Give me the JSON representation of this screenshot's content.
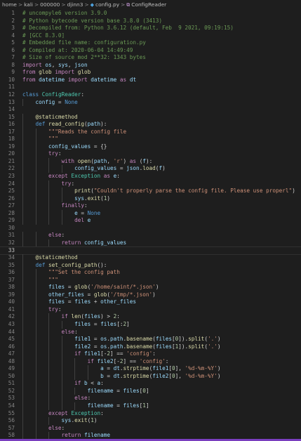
{
  "breadcrumb": {
    "items": [
      "home",
      "kali",
      "000000",
      "djinn3"
    ],
    "file": "config.py",
    "symbol": "ConfigReader",
    "separator": ">"
  },
  "colors": {
    "background": "#1e1e1e",
    "comment": "#6a9955",
    "keyword": "#c586c0",
    "storage": "#569cd6",
    "class": "#4ec9b0",
    "function": "#dcdcaa",
    "variable": "#9cdcfe",
    "string": "#ce9178",
    "number": "#b5cea8"
  },
  "editor": {
    "current_line": 33,
    "lines": [
      {
        "n": 1,
        "t": "# uncompyle6 version 3.9.0"
      },
      {
        "n": 2,
        "t": "# Python bytecode version base 3.8.0 (3413)"
      },
      {
        "n": 3,
        "t": "# Decompiled from: Python 3.6.12 (default, Feb  9 2021, 09:19:15)"
      },
      {
        "n": 4,
        "t": "# [GCC 8.3.0]"
      },
      {
        "n": 5,
        "t": "# Embedded file name: configuration.py"
      },
      {
        "n": 6,
        "t": "# Compiled at: 2020-06-04 14:49:49"
      },
      {
        "n": 7,
        "t": "# Size of source mod 2**32: 1343 bytes"
      },
      {
        "n": 8,
        "t": "import os, sys, json"
      },
      {
        "n": 9,
        "t": "from glob import glob"
      },
      {
        "n": 10,
        "t": "from datetime import datetime as dt"
      },
      {
        "n": 11,
        "t": ""
      },
      {
        "n": 12,
        "t": "class ConfigReader:"
      },
      {
        "n": 13,
        "t": "    config = None"
      },
      {
        "n": 14,
        "t": ""
      },
      {
        "n": 15,
        "t": "    @staticmethod"
      },
      {
        "n": 16,
        "t": "    def read_config(path):"
      },
      {
        "n": 17,
        "t": "        \"\"\"Reads the config file"
      },
      {
        "n": 18,
        "t": "        \"\"\""
      },
      {
        "n": 19,
        "t": "        config_values = {}"
      },
      {
        "n": 20,
        "t": "        try:"
      },
      {
        "n": 21,
        "t": "            with open(path, 'r') as (f):"
      },
      {
        "n": 22,
        "t": "                config_values = json.load(f)"
      },
      {
        "n": 23,
        "t": "        except Exception as e:"
      },
      {
        "n": 24,
        "t": "            try:"
      },
      {
        "n": 25,
        "t": "                print(\"Couldn't properly parse the config file. Please use properl\")"
      },
      {
        "n": 26,
        "t": "                sys.exit(1)"
      },
      {
        "n": 27,
        "t": "            finally:"
      },
      {
        "n": 28,
        "t": "                e = None"
      },
      {
        "n": 29,
        "t": "                del e"
      },
      {
        "n": 30,
        "t": ""
      },
      {
        "n": 31,
        "t": "        else:"
      },
      {
        "n": 32,
        "t": "            return config_values"
      },
      {
        "n": 33,
        "t": ""
      },
      {
        "n": 34,
        "t": "    @staticmethod"
      },
      {
        "n": 35,
        "t": "    def set_config_path():"
      },
      {
        "n": 36,
        "t": "        \"\"\"Set the config path"
      },
      {
        "n": 37,
        "t": "        \"\"\""
      },
      {
        "n": 38,
        "t": "        files = glob('/home/saint/*.json')"
      },
      {
        "n": 39,
        "t": "        other_files = glob('/tmp/*.json')"
      },
      {
        "n": 40,
        "t": "        files = files + other_files"
      },
      {
        "n": 41,
        "t": "        try:"
      },
      {
        "n": 42,
        "t": "            if len(files) > 2:"
      },
      {
        "n": 43,
        "t": "                files = files[:2]"
      },
      {
        "n": 44,
        "t": "            else:"
      },
      {
        "n": 45,
        "t": "                file1 = os.path.basename(files[0]).split('.')"
      },
      {
        "n": 46,
        "t": "                file2 = os.path.basename(files[1]).split('.')"
      },
      {
        "n": 47,
        "t": "                if file1[-2] == 'config':"
      },
      {
        "n": 48,
        "t": "                    if file2[-2] == 'config':"
      },
      {
        "n": 49,
        "t": "                        a = dt.strptime(file1[0], '%d-%m-%Y')"
      },
      {
        "n": 50,
        "t": "                        b = dt.strptime(file2[0], '%d-%m-%Y')"
      },
      {
        "n": 51,
        "t": "                if b < a:"
      },
      {
        "n": 52,
        "t": "                    filename = files[0]"
      },
      {
        "n": 53,
        "t": "                else:"
      },
      {
        "n": 54,
        "t": "                    filename = files[1]"
      },
      {
        "n": 55,
        "t": "        except Exception:"
      },
      {
        "n": 56,
        "t": "            sys.exit(1)"
      },
      {
        "n": 57,
        "t": "        else:"
      },
      {
        "n": 58,
        "t": "            return filename"
      }
    ]
  }
}
